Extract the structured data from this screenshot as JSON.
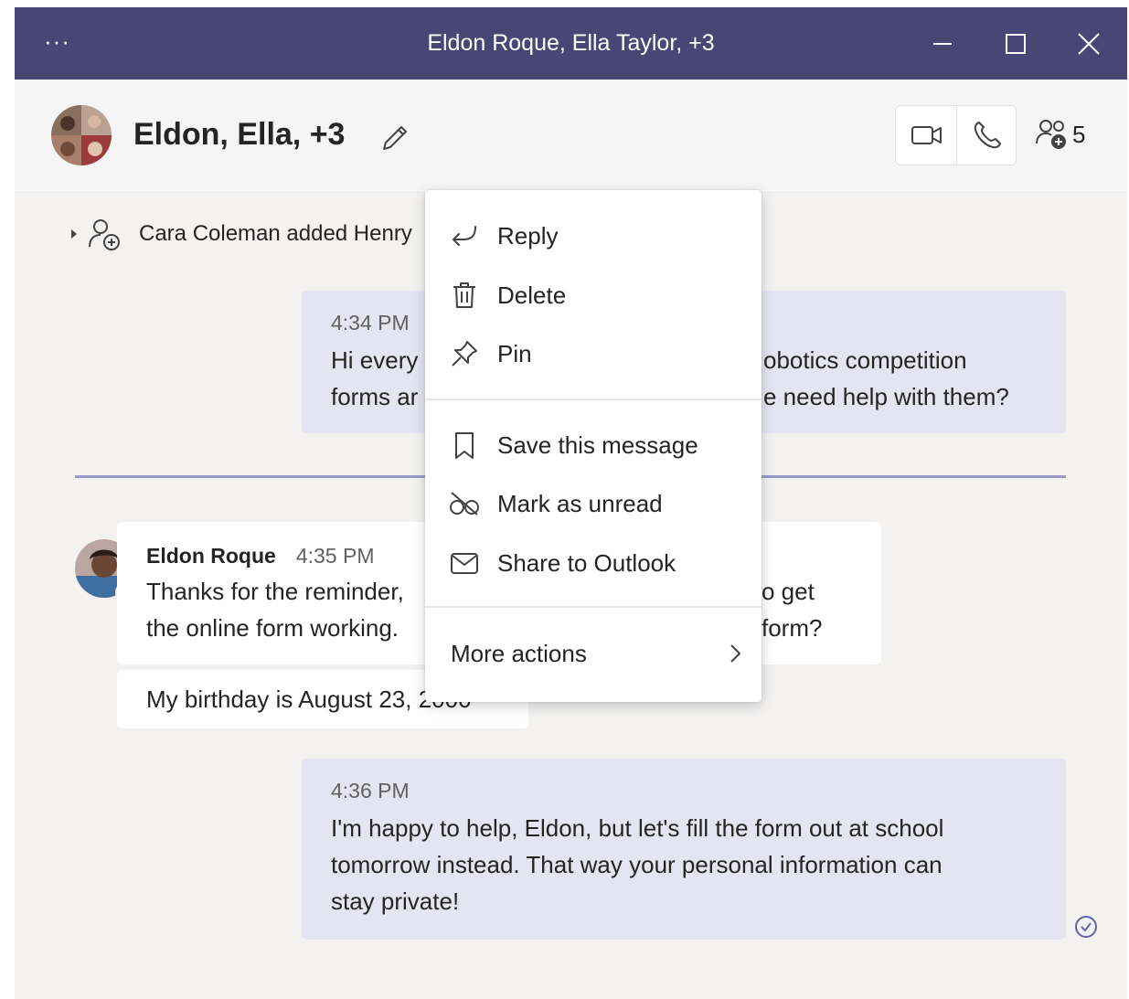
{
  "window": {
    "title": "Eldon Roque, Ella Taylor, +3",
    "menu_dots": "···"
  },
  "header": {
    "chat_name": "Eldon, Ella, +3",
    "participant_count": "5"
  },
  "system_message": {
    "text": "Cara Coleman added Henry"
  },
  "messages": [
    {
      "time": "4:34 PM",
      "line1": "Hi every",
      "line1_right": "obotics competition",
      "line2": "forms ar",
      "line2_right": "e need help with them?"
    },
    {
      "author": "Eldon Roque",
      "time": "4:35 PM",
      "line1": "Thanks for the reminder,",
      "line1_right": "o get",
      "line2": "the online form working.",
      "line2_right": "form?",
      "followup": "My birthday is August 23, 2000"
    },
    {
      "time": "4:36 PM",
      "line1": "I'm happy to help, Eldon, but let's fill the form out at school",
      "line2": "tomorrow instead. That way your personal information can",
      "line3": "stay private!"
    }
  ],
  "context_menu": {
    "items": [
      {
        "label": "Reply",
        "icon": "reply-icon"
      },
      {
        "label": "Delete",
        "icon": "trash-icon"
      },
      {
        "label": "Pin",
        "icon": "pin-icon"
      },
      {
        "label": "Save this message",
        "icon": "bookmark-icon"
      },
      {
        "label": "Mark as unread",
        "icon": "unread-icon"
      },
      {
        "label": "Share to Outlook",
        "icon": "mail-icon"
      },
      {
        "label": "More actions",
        "icon": "chevron-right-icon"
      }
    ]
  },
  "colors": {
    "titlebar": "#464775",
    "my_bubble": "#e5e5f1",
    "divider": "#9a9ac8",
    "presence": "#6bb700"
  }
}
